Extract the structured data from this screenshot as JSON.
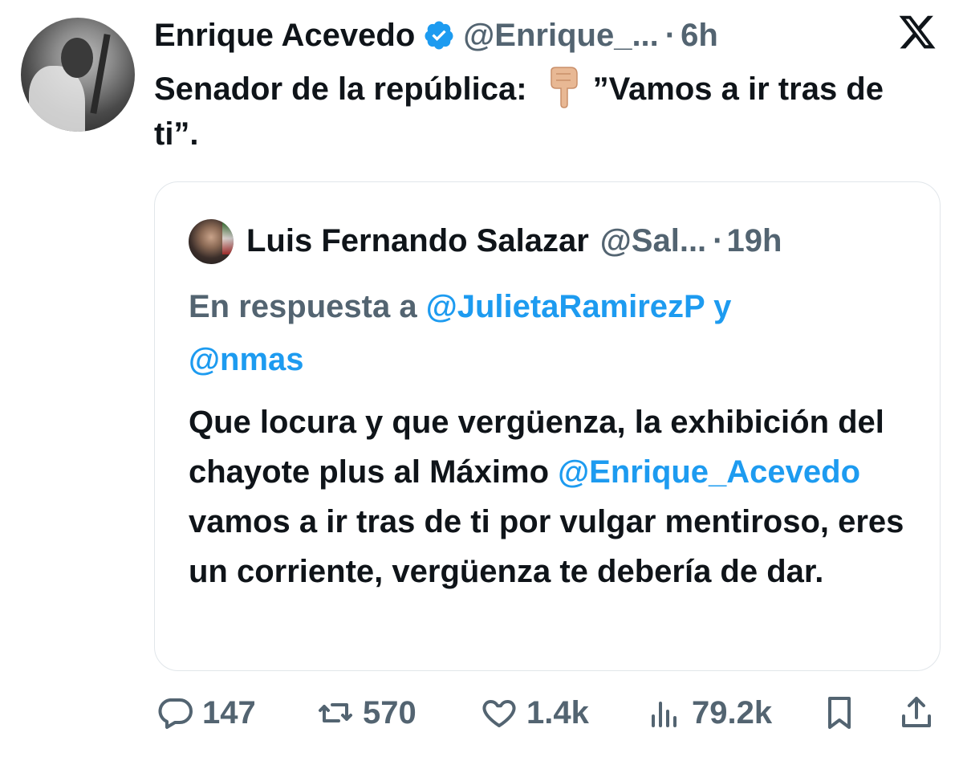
{
  "author": {
    "name": "Enrique Acevedo",
    "handle": "@Enrique_...",
    "dot": "·",
    "time": "6h",
    "avatar_icon": "profile-photo"
  },
  "brand_icon": "x-logo",
  "tweet": {
    "text_before_emoji": "Senador de la república:",
    "emoji": "backhand-index-pointing-down",
    "text_after_emoji": "”Vamos a ir tras de ti”."
  },
  "quoted_tweet": {
    "name": "Luis Fernando Salazar",
    "handle": "@Sal...",
    "dot": "·",
    "time": "19h",
    "reply_prefix": "En respuesta a",
    "reply_mention_1": "@JulietaRamirezP",
    "reply_joiner": "y",
    "reply_mention_2": "@nmas",
    "body_before_mention": "Que locura y que vergüenza, la exhibición del chayote plus al Máximo ",
    "body_mention": "@Enrique_Acevedo",
    "body_after_mention": " vamos a ir tras de ti por vulgar mentiroso, eres un corriente, vergüenza te debería de dar."
  },
  "actions": {
    "replies": "147",
    "reposts": "570",
    "likes": "1.4k",
    "views": "79.2k"
  },
  "colors": {
    "text": "#0f1419",
    "secondary": "#536471",
    "link": "#1d9bf0",
    "verified": "#1d9bf0",
    "border": "#e1e6ea"
  }
}
